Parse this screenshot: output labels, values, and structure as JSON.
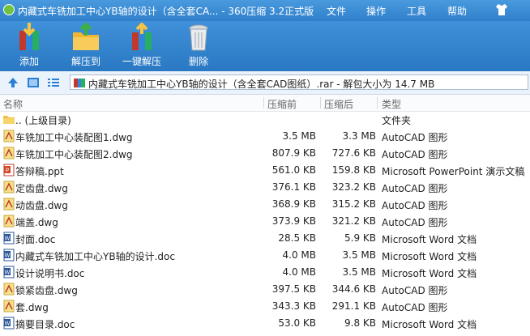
{
  "window": {
    "title": "内藏式车铣加工中心YB轴的设计（含全套CA... - 360压缩 3.2正式版",
    "menu": [
      "文件",
      "操作",
      "工具",
      "帮助"
    ]
  },
  "toolbar": {
    "add": "添加",
    "extract_to": "解压到",
    "one_click_extract": "一键解压",
    "delete": "删除"
  },
  "address": {
    "path": "内藏式车铣加工中心YB轴的设计（含全套CAD图纸）.rar - 解包大小为 14.7 MB"
  },
  "columns": {
    "name": "名称",
    "packed": "压缩前",
    "unpacked": "压缩后",
    "type": "类型"
  },
  "files": [
    {
      "icon": "folder-up-icon",
      "name": ".. (上级目录)",
      "size": "",
      "packed": "",
      "type": "文件夹"
    },
    {
      "icon": "dwg-file-icon",
      "name": "车铣加工中心装配图1.dwg",
      "size": "3.5 MB",
      "packed": "3.3 MB",
      "type": "AutoCAD 图形"
    },
    {
      "icon": "dwg-file-icon",
      "name": "车铣加工中心装配图2.dwg",
      "size": "807.9 KB",
      "packed": "727.6 KB",
      "type": "AutoCAD 图形"
    },
    {
      "icon": "ppt-file-icon",
      "name": "答辩稿.ppt",
      "size": "561.0 KB",
      "packed": "159.8 KB",
      "type": "Microsoft PowerPoint 演示文稿"
    },
    {
      "icon": "dwg-file-icon",
      "name": "定齿盘.dwg",
      "size": "376.1 KB",
      "packed": "323.2 KB",
      "type": "AutoCAD 图形"
    },
    {
      "icon": "dwg-file-icon",
      "name": "动齿盘.dwg",
      "size": "368.9 KB",
      "packed": "315.2 KB",
      "type": "AutoCAD 图形"
    },
    {
      "icon": "dwg-file-icon",
      "name": "端盖.dwg",
      "size": "373.9 KB",
      "packed": "321.2 KB",
      "type": "AutoCAD 图形"
    },
    {
      "icon": "doc-file-icon",
      "name": "封面.doc",
      "size": "28.5 KB",
      "packed": "5.9 KB",
      "type": "Microsoft Word 文档"
    },
    {
      "icon": "doc-file-icon",
      "name": "内藏式车铣加工中心YB轴的设计.doc",
      "size": "4.0 MB",
      "packed": "3.5 MB",
      "type": "Microsoft Word 文档"
    },
    {
      "icon": "doc-file-icon",
      "name": "设计说明书.doc",
      "size": "4.0 MB",
      "packed": "3.5 MB",
      "type": "Microsoft Word 文档"
    },
    {
      "icon": "dwg-file-icon",
      "name": "锁紧齿盘.dwg",
      "size": "397.5 KB",
      "packed": "344.6 KB",
      "type": "AutoCAD 图形"
    },
    {
      "icon": "dwg-file-icon",
      "name": "套.dwg",
      "size": "343.3 KB",
      "packed": "291.1 KB",
      "type": "AutoCAD 图形"
    },
    {
      "icon": "doc-file-icon",
      "name": "摘要目录.doc",
      "size": "53.0 KB",
      "packed": "9.8 KB",
      "type": "Microsoft Word 文档"
    }
  ]
}
